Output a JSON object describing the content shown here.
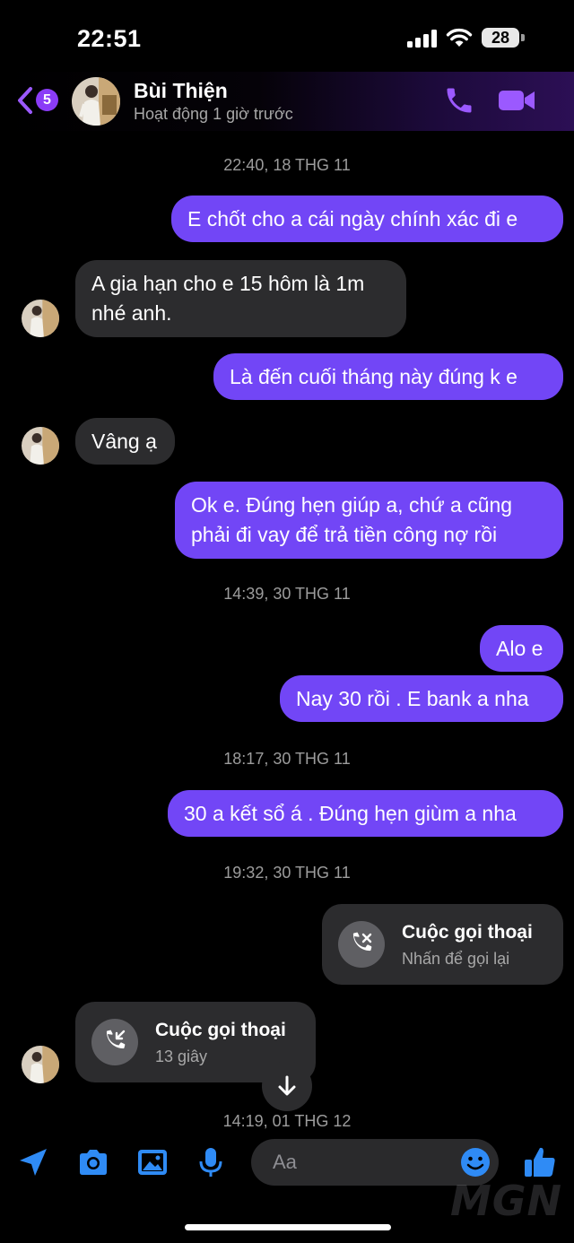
{
  "status_bar": {
    "time": "22:51",
    "battery": "28"
  },
  "header": {
    "back_count": "5",
    "contact_name": "Bùi Thiện",
    "contact_status": "Hoạt động 1 giờ trước"
  },
  "messages": {
    "ts1": "22:40, 18 THG 11",
    "m1": "E chốt cho a cái ngày chính xác đi e",
    "m2_line1": "A gia hạn cho e 15 hôm là 1m",
    "m2_line2": "nhé anh.",
    "m3": "Là đến cuối tháng này đúng k e",
    "m4": "Vâng ạ",
    "m5_line1": "Ok e. Đúng hẹn giúp a, chứ a cũng",
    "m5_line2": "phải đi vay để trả tiền công nợ rồi",
    "ts2": "14:39, 30 THG 11",
    "m6": "Alo e",
    "m7": "Nay 30 rồi . E bank a nha",
    "ts3": "18:17, 30 THG 11",
    "m8": "30 a kết sổ á . Đúng hẹn giùm a nha",
    "ts4": "19:32, 30 THG 11",
    "call1_title": "Cuộc gọi thoại",
    "call1_sub": "Nhấn để gọi lại",
    "call2_title": "Cuộc gọi thoại",
    "call2_sub": "13 giây",
    "ts5": "14:19, 01 THG 12"
  },
  "composer": {
    "placeholder": "Aa"
  },
  "watermark": "MGN",
  "colors": {
    "outgoing": "#7246f6",
    "incoming": "#2c2c2e",
    "accent": "#8b3cf7",
    "composer_icons": "#2f8bf5"
  },
  "icons": [
    "back-chevron-icon",
    "phone-icon",
    "video-camera-icon",
    "missed-call-icon",
    "incoming-call-icon",
    "chevron-down-icon",
    "location-arrow-icon",
    "camera-icon",
    "image-icon",
    "microphone-icon",
    "emoji-icon",
    "thumbs-up-icon"
  ]
}
